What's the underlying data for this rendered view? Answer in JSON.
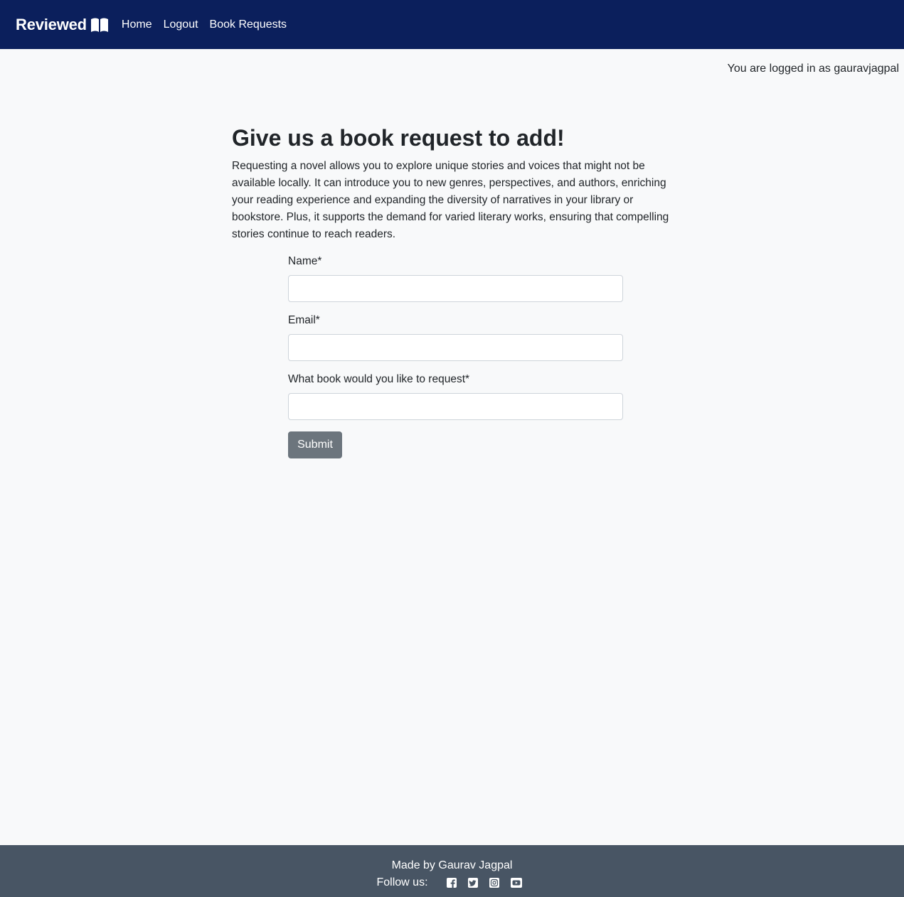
{
  "nav": {
    "brand": "Reviewed",
    "brand_icon": "book-open-icon",
    "links": [
      "Home",
      "Logout",
      "Book Requests"
    ]
  },
  "status": {
    "logged_in_text": "You are logged in as gauravjagpal"
  },
  "main": {
    "title": "Give us a book request to add!",
    "intro": "Requesting a novel allows you to explore unique stories and voices that might not be available locally. It can introduce you to new genres, perspectives, and authors, enriching your reading experience and expanding the diversity of narratives in your library or bookstore. Plus, it supports the demand for varied literary works, ensuring that compelling stories continue to reach readers."
  },
  "form": {
    "fields": [
      {
        "label": "Name*",
        "value": "",
        "placeholder": ""
      },
      {
        "label": "Email*",
        "value": "",
        "placeholder": ""
      },
      {
        "label": "What book would you like to request*",
        "value": "",
        "placeholder": ""
      }
    ],
    "submit_label": "Submit"
  },
  "footer": {
    "made_by": "Made by Gaurav Jagpal",
    "follow_label": "Follow us:",
    "social_icons": [
      "facebook-icon",
      "twitter-icon",
      "instagram-icon",
      "youtube-icon"
    ]
  },
  "colors": {
    "navbar": "#0b1f5c",
    "footer": "#485564",
    "button": "#6c757d",
    "background": "#f8f9fa"
  }
}
